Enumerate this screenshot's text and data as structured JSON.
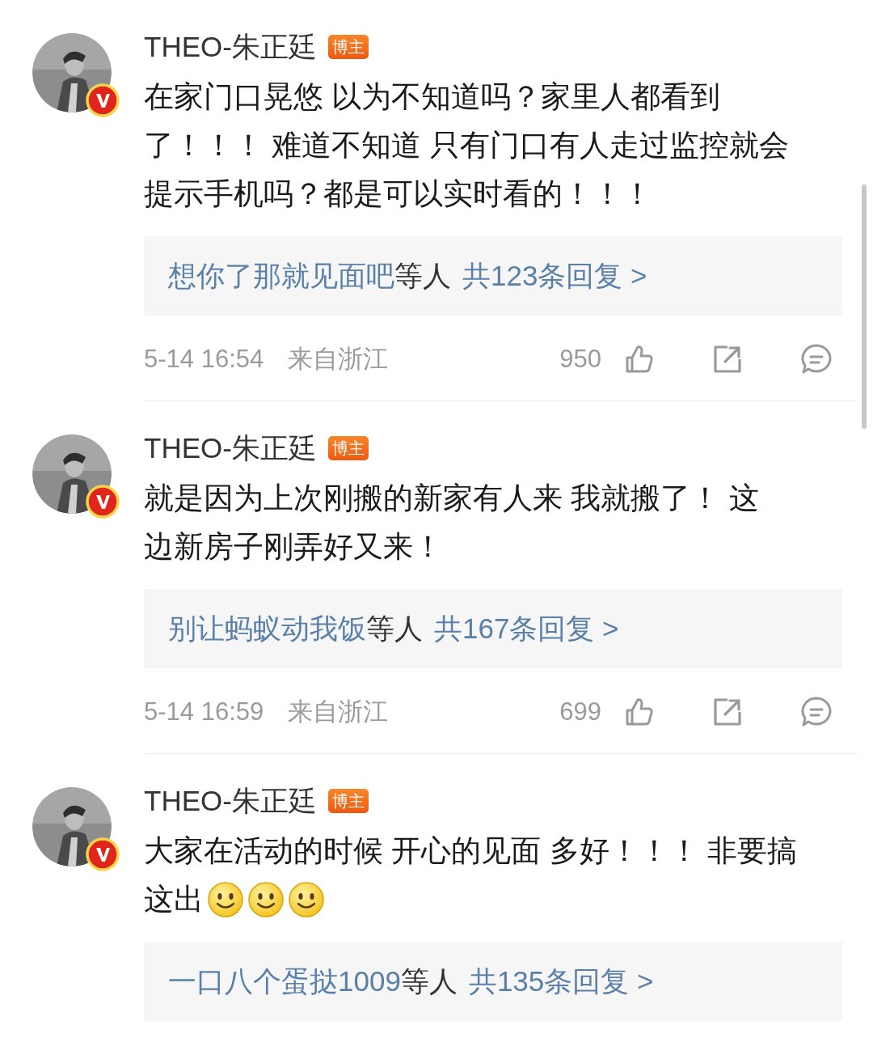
{
  "comments": [
    {
      "author": "THEO-朱正廷",
      "badge": "博主",
      "verified": true,
      "text": [
        "在家门口晃悠 以为不知道吗？家里人都看到",
        "了！！！ 难道不知道 只有门口有人走过监控就会",
        "提示手机吗？都是可以实时看的！！！"
      ],
      "replies": {
        "replier": "想你了那就见面吧",
        "suffix": "等人",
        "count_text": "共123条回复 >"
      },
      "time": "5-14 16:54",
      "location": "来自浙江",
      "likes": "950"
    },
    {
      "author": "THEO-朱正廷",
      "badge": "博主",
      "verified": true,
      "text": [
        "就是因为上次刚搬的新家有人来 我就搬了！ 这",
        "边新房子刚弄好又来！"
      ],
      "replies": {
        "replier": "别让蚂蚁动我饭",
        "suffix": "等人",
        "count_text": "共167条回复 >"
      },
      "time": "5-14 16:59",
      "location": "来自浙江",
      "likes": "699"
    },
    {
      "author": "THEO-朱正廷",
      "badge": "博主",
      "verified": true,
      "text": [
        "大家在活动的时候 开心的见面 多好！！！ 非要搞",
        "这出"
      ],
      "emojis": [
        {
          "kind": "smile"
        },
        {
          "kind": "smile"
        },
        {
          "kind": "smile"
        }
      ],
      "replies": {
        "replier": "一口八个蛋挞1009",
        "suffix": "等人",
        "count_text": "共135条回复 >"
      }
    }
  ]
}
